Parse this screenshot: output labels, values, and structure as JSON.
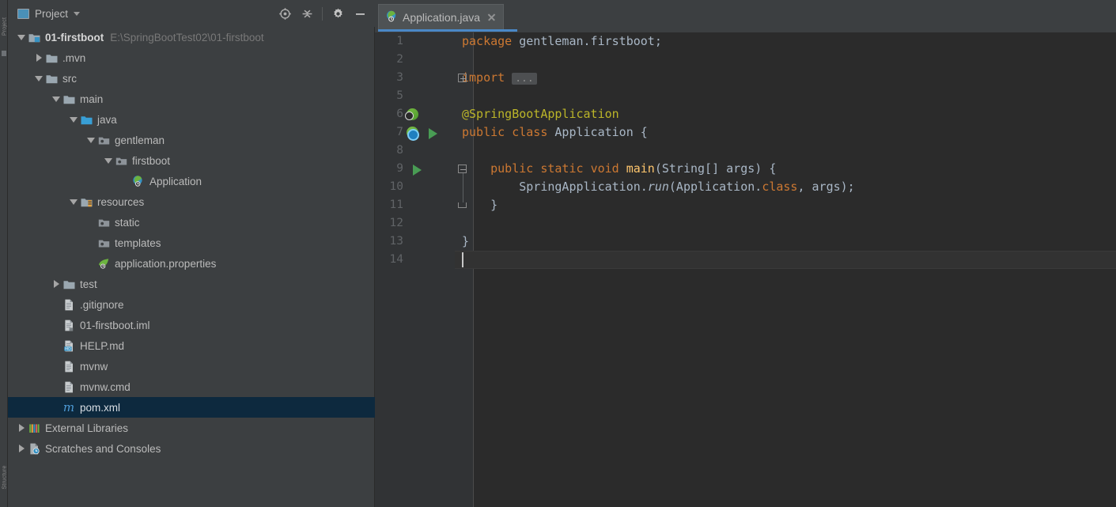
{
  "window": {
    "left_strip_labels": [
      "Project",
      "Structure"
    ]
  },
  "project_toolbar": {
    "title": "Project",
    "dropdown_caret": "chevron-down",
    "actions": [
      {
        "name": "locate-in-tree",
        "tooltip": "Select Opened File"
      },
      {
        "name": "collapse-all",
        "tooltip": "Collapse All"
      },
      {
        "name": "settings-gear",
        "tooltip": "Settings"
      },
      {
        "name": "hide-panel",
        "tooltip": "Hide"
      }
    ]
  },
  "tree": {
    "items": [
      {
        "label": "01-firstboot",
        "suffix": "E:\\SpringBootTest02\\01-firstboot",
        "indent": 0,
        "twisty": "open",
        "icon": "module-icon",
        "bold": true,
        "selected": false
      },
      {
        "label": ".mvn",
        "suffix": "",
        "indent": 1,
        "twisty": "closed",
        "icon": "folder-icon",
        "bold": false,
        "selected": false
      },
      {
        "label": "src",
        "suffix": "",
        "indent": 1,
        "twisty": "open",
        "icon": "folder-icon",
        "bold": false,
        "selected": false
      },
      {
        "label": "main",
        "suffix": "",
        "indent": 2,
        "twisty": "open",
        "icon": "folder-icon",
        "bold": false,
        "selected": false
      },
      {
        "label": "java",
        "suffix": "",
        "indent": 3,
        "twisty": "open",
        "icon": "source-root-icon",
        "bold": false,
        "selected": false
      },
      {
        "label": "gentleman",
        "suffix": "",
        "indent": 4,
        "twisty": "open",
        "icon": "package-icon",
        "bold": false,
        "selected": false
      },
      {
        "label": "firstboot",
        "suffix": "",
        "indent": 5,
        "twisty": "open",
        "icon": "package-icon",
        "bold": false,
        "selected": false
      },
      {
        "label": "Application",
        "suffix": "",
        "indent": 6,
        "twisty": "none",
        "icon": "spring-class-icon",
        "bold": false,
        "selected": false
      },
      {
        "label": "resources",
        "suffix": "",
        "indent": 3,
        "twisty": "open",
        "icon": "resource-root-icon",
        "bold": false,
        "selected": false
      },
      {
        "label": "static",
        "suffix": "",
        "indent": 4,
        "twisty": "none",
        "icon": "package-icon",
        "bold": false,
        "selected": false
      },
      {
        "label": "templates",
        "suffix": "",
        "indent": 4,
        "twisty": "none",
        "icon": "package-icon",
        "bold": false,
        "selected": false
      },
      {
        "label": "application.properties",
        "suffix": "",
        "indent": 4,
        "twisty": "none",
        "icon": "spring-props-icon",
        "bold": false,
        "selected": false
      },
      {
        "label": "test",
        "suffix": "",
        "indent": 2,
        "twisty": "closed",
        "icon": "folder-icon",
        "bold": false,
        "selected": false
      },
      {
        "label": ".gitignore",
        "suffix": "",
        "indent": 2,
        "twisty": "none",
        "icon": "file-icon",
        "bold": false,
        "selected": false
      },
      {
        "label": "01-firstboot.iml",
        "suffix": "",
        "indent": 2,
        "twisty": "none",
        "icon": "iml-file-icon",
        "bold": false,
        "selected": false
      },
      {
        "label": "HELP.md",
        "suffix": "",
        "indent": 2,
        "twisty": "none",
        "icon": "markdown-file-icon",
        "bold": false,
        "selected": false
      },
      {
        "label": "mvnw",
        "suffix": "",
        "indent": 2,
        "twisty": "none",
        "icon": "file-icon",
        "bold": false,
        "selected": false
      },
      {
        "label": "mvnw.cmd",
        "suffix": "",
        "indent": 2,
        "twisty": "none",
        "icon": "file-icon",
        "bold": false,
        "selected": false
      },
      {
        "label": "pom.xml",
        "suffix": "",
        "indent": 2,
        "twisty": "none",
        "icon": "maven-icon",
        "bold": false,
        "selected": true
      },
      {
        "label": "External Libraries",
        "suffix": "",
        "indent": 0,
        "twisty": "closed",
        "icon": "libraries-icon",
        "bold": false,
        "selected": false
      },
      {
        "label": "Scratches and Consoles",
        "suffix": "",
        "indent": 0,
        "twisty": "closed",
        "icon": "scratches-icon",
        "bold": false,
        "selected": false
      }
    ]
  },
  "editor": {
    "tab": {
      "filename": "Application.java",
      "icon": "spring-class-icon",
      "close": "close-icon",
      "active": true
    },
    "line_numbers": [
      1,
      2,
      3,
      5,
      6,
      7,
      8,
      9,
      10,
      11,
      12,
      13,
      14
    ],
    "caret_line_index": 12,
    "caret_line_number": 14,
    "code_lines": [
      {
        "n": 1,
        "tokens": [
          {
            "t": "package",
            "c": "kw"
          },
          {
            "t": " gentleman.firstboot;",
            "c": "id"
          }
        ]
      },
      {
        "n": 2,
        "tokens": []
      },
      {
        "n": 3,
        "tokens": [
          {
            "t": "import",
            "c": "kw"
          },
          {
            "t": " ",
            "c": "id"
          },
          {
            "t": "...",
            "c": "fold"
          }
        ]
      },
      {
        "n": 5,
        "tokens": []
      },
      {
        "n": 6,
        "tokens": [
          {
            "t": "@SpringBootApplication",
            "c": "ann"
          }
        ]
      },
      {
        "n": 7,
        "tokens": [
          {
            "t": "public",
            "c": "kw"
          },
          {
            "t": " ",
            "c": "id"
          },
          {
            "t": "class",
            "c": "kw"
          },
          {
            "t": " Application {",
            "c": "id"
          }
        ]
      },
      {
        "n": 8,
        "tokens": []
      },
      {
        "n": 9,
        "tokens": [
          {
            "t": "    ",
            "c": "id"
          },
          {
            "t": "public",
            "c": "kw"
          },
          {
            "t": " ",
            "c": "id"
          },
          {
            "t": "static",
            "c": "kw"
          },
          {
            "t": " ",
            "c": "id"
          },
          {
            "t": "void",
            "c": "kw"
          },
          {
            "t": " ",
            "c": "id"
          },
          {
            "t": "main",
            "c": "mth"
          },
          {
            "t": "(String[] args) {",
            "c": "id"
          }
        ]
      },
      {
        "n": 10,
        "tokens": [
          {
            "t": "        SpringApplication.",
            "c": "id"
          },
          {
            "t": "run",
            "c": "itl"
          },
          {
            "t": "(Application.",
            "c": "id"
          },
          {
            "t": "class",
            "c": "kw"
          },
          {
            "t": ", args);",
            "c": "id"
          }
        ]
      },
      {
        "n": 11,
        "tokens": [
          {
            "t": "    }",
            "c": "id"
          }
        ]
      },
      {
        "n": 12,
        "tokens": []
      },
      {
        "n": 13,
        "tokens": [
          {
            "t": "}",
            "c": "id"
          }
        ]
      },
      {
        "n": 14,
        "tokens": []
      }
    ],
    "gutter_icons": [
      {
        "line": 6,
        "name": "spring-bean-gutter-icon",
        "kind": "bean"
      },
      {
        "line": 7,
        "name": "spring-boot-gutter-icon",
        "kind": "spring"
      },
      {
        "line": 7,
        "name": "run-application-gutter-icon",
        "kind": "run"
      },
      {
        "line": 9,
        "name": "run-main-method-gutter-icon",
        "kind": "run"
      }
    ],
    "fold_markers": [
      {
        "line": 3,
        "kind": "expand"
      },
      {
        "line": 9,
        "kind": "region-start"
      },
      {
        "line": 11,
        "kind": "region-end"
      }
    ]
  },
  "colors": {
    "panel_bg": "#3c3f41",
    "editor_bg": "#2b2b2b",
    "gutter_bg": "#313335",
    "selection_bg": "#0d293e",
    "tab_active_underline": "#4a88c7",
    "keyword": "#cc7832",
    "identifier": "#a9b7c6",
    "annotation": "#bbb529",
    "method": "#ffc66d",
    "line_number": "#606366",
    "run_green": "#499c54"
  }
}
